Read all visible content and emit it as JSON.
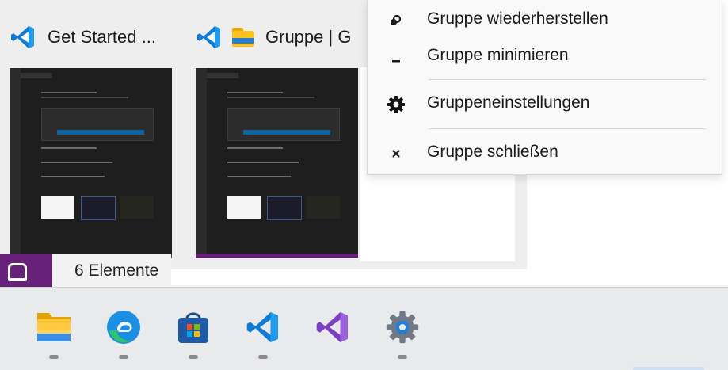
{
  "thumbnails": [
    {
      "title": "Get Started ...",
      "icons": [
        "vscode-icon"
      ]
    },
    {
      "title": "Gruppe | G",
      "icons": [
        "vscode-icon",
        "folder-icon"
      ]
    }
  ],
  "background": {
    "status_text": "6 Elemente"
  },
  "context_menu": {
    "items": [
      {
        "label": "Gruppe wiederherstellen",
        "icon": "restore-icon"
      },
      {
        "label": "Gruppe minimieren",
        "icon": "minimize-icon"
      },
      {
        "label": "Gruppeneinstellungen",
        "icon": "gear-icon"
      },
      {
        "label": "Gruppe schließen",
        "icon": "close-icon"
      }
    ]
  },
  "taskbar": {
    "apps": [
      {
        "name": "File Explorer",
        "icon": "file-explorer-icon"
      },
      {
        "name": "Microsoft Edge",
        "icon": "edge-icon"
      },
      {
        "name": "Microsoft Store",
        "icon": "store-icon"
      },
      {
        "name": "Visual Studio Code",
        "icon": "vscode-icon"
      },
      {
        "name": "Visual Studio",
        "icon": "visual-studio-icon"
      },
      {
        "name": "Settings",
        "icon": "settings-icon"
      }
    ]
  },
  "colors": {
    "vscode_blue": "#0f7bd9",
    "visual_studio_purple": "#8a4bd6",
    "status_purple": "#68217a",
    "edge_blue": "#1a8fe3",
    "edge_green": "#31c26e"
  }
}
